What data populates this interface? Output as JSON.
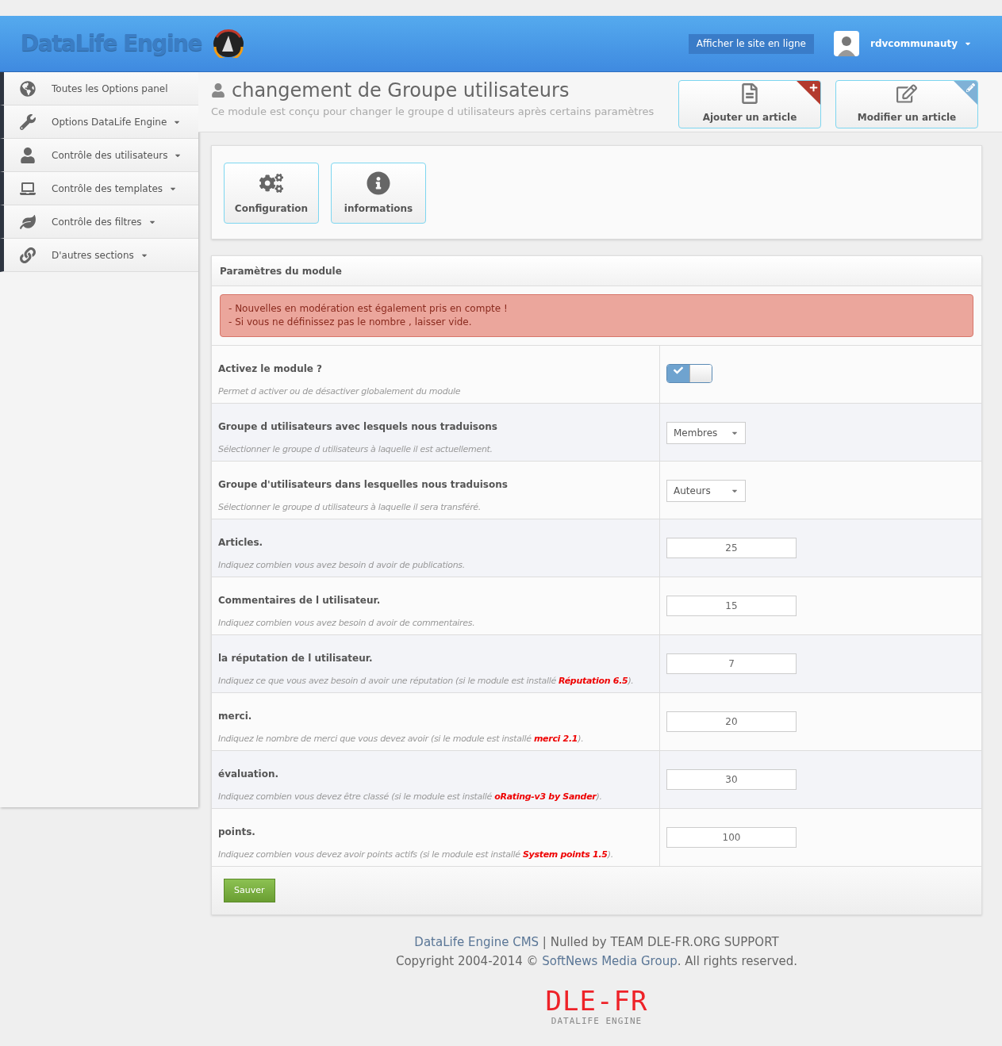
{
  "header": {
    "logo": "DataLife Engine",
    "view_site": "Afficher le site en ligne",
    "user": "rdvcommunauty"
  },
  "sidebar": {
    "items": [
      {
        "label": "Toutes les Options panel",
        "dropdown": false
      },
      {
        "label": "Options DataLife Engine",
        "dropdown": true
      },
      {
        "label": "Contrôle des utilisateurs",
        "dropdown": true
      },
      {
        "label": "Contrôle des templates",
        "dropdown": true
      },
      {
        "label": "Contrôle des filtres",
        "dropdown": true
      },
      {
        "label": "D'autres sections",
        "dropdown": true
      }
    ]
  },
  "page": {
    "title": "changement de Groupe utilisateurs",
    "subtitle": "Ce module est conçu pour changer le groupe d utilisateurs après certains paramètres",
    "quick_actions": [
      {
        "label": "Ajouter un article",
        "color": "#b33a2e"
      },
      {
        "label": "Modifier un article",
        "color": "#7fb1d6"
      }
    ]
  },
  "module_tabs": [
    {
      "label": "Configuration"
    },
    {
      "label": "informations"
    }
  ],
  "settings": {
    "title": "Paramètres du module",
    "alert": [
      "- Nouvelles en modération est également pris en compte !",
      "- Si vous ne définissez pas le nombre , laisser vide."
    ],
    "rows": [
      {
        "kind": "toggle",
        "label": "Activez le module ?",
        "hint": "Permet d activer ou de désactiver globalement du module",
        "on": true
      },
      {
        "kind": "select",
        "label": "Groupe d utilisateurs avec lesquels nous traduisons",
        "hint": "Sélectionner le groupe d utilisateurs à laquelle il est actuellement.",
        "value": "Membres"
      },
      {
        "kind": "select",
        "label": "Groupe d'utilisateurs dans lesquelles nous traduisons",
        "hint": "Sélectionner le groupe d utilisateurs à laquelle il sera transféré.",
        "value": "Auteurs"
      },
      {
        "kind": "number",
        "label": "Articles.",
        "hint": "Indiquez combien vous avez besoin d avoir de publications.",
        "value": "25"
      },
      {
        "kind": "number",
        "label": "Commentaires de l utilisateur.",
        "hint": "Indiquez combien vous avez besoin d avoir de commentaires.",
        "value": "15"
      },
      {
        "kind": "number",
        "label": "la réputation de l utilisateur.",
        "hint": "Indiquez ce que vous avez besoin d avoir une réputation (si le module est installé ",
        "link": "Réputation 6.5",
        "hint_end": ").",
        "value": "7"
      },
      {
        "kind": "number",
        "label": "merci.",
        "hint": "Indiquez le nombre de merci que vous devez avoir (si le module est installé ",
        "link": "merci 2.1",
        "hint_end": ").",
        "value": "20"
      },
      {
        "kind": "number",
        "label": "évaluation.",
        "hint": "Indiquez combien vous devez être classé (si le module est installé ",
        "link": "oRating-v3 by Sander",
        "hint_end": ").",
        "value": "30"
      },
      {
        "kind": "number",
        "label": "points.",
        "hint": "Indiquez combien vous devez avoir points actifs (si le module est installé ",
        "link": "System points 1.5",
        "hint_end": ").",
        "value": "100"
      }
    ],
    "save": "Sauver"
  },
  "footer": {
    "product": "DataLife Engine CMS",
    "credit": " | Nulled by TEAM DLE-FR.ORG SUPPORT",
    "copyright": "Copyright 2004-2014 © ",
    "company": "SoftNews Media Group",
    "rights": ". All rights reserved.",
    "logo": "DLE-FR",
    "logo_sub": "DATALIFE ENGINE"
  }
}
